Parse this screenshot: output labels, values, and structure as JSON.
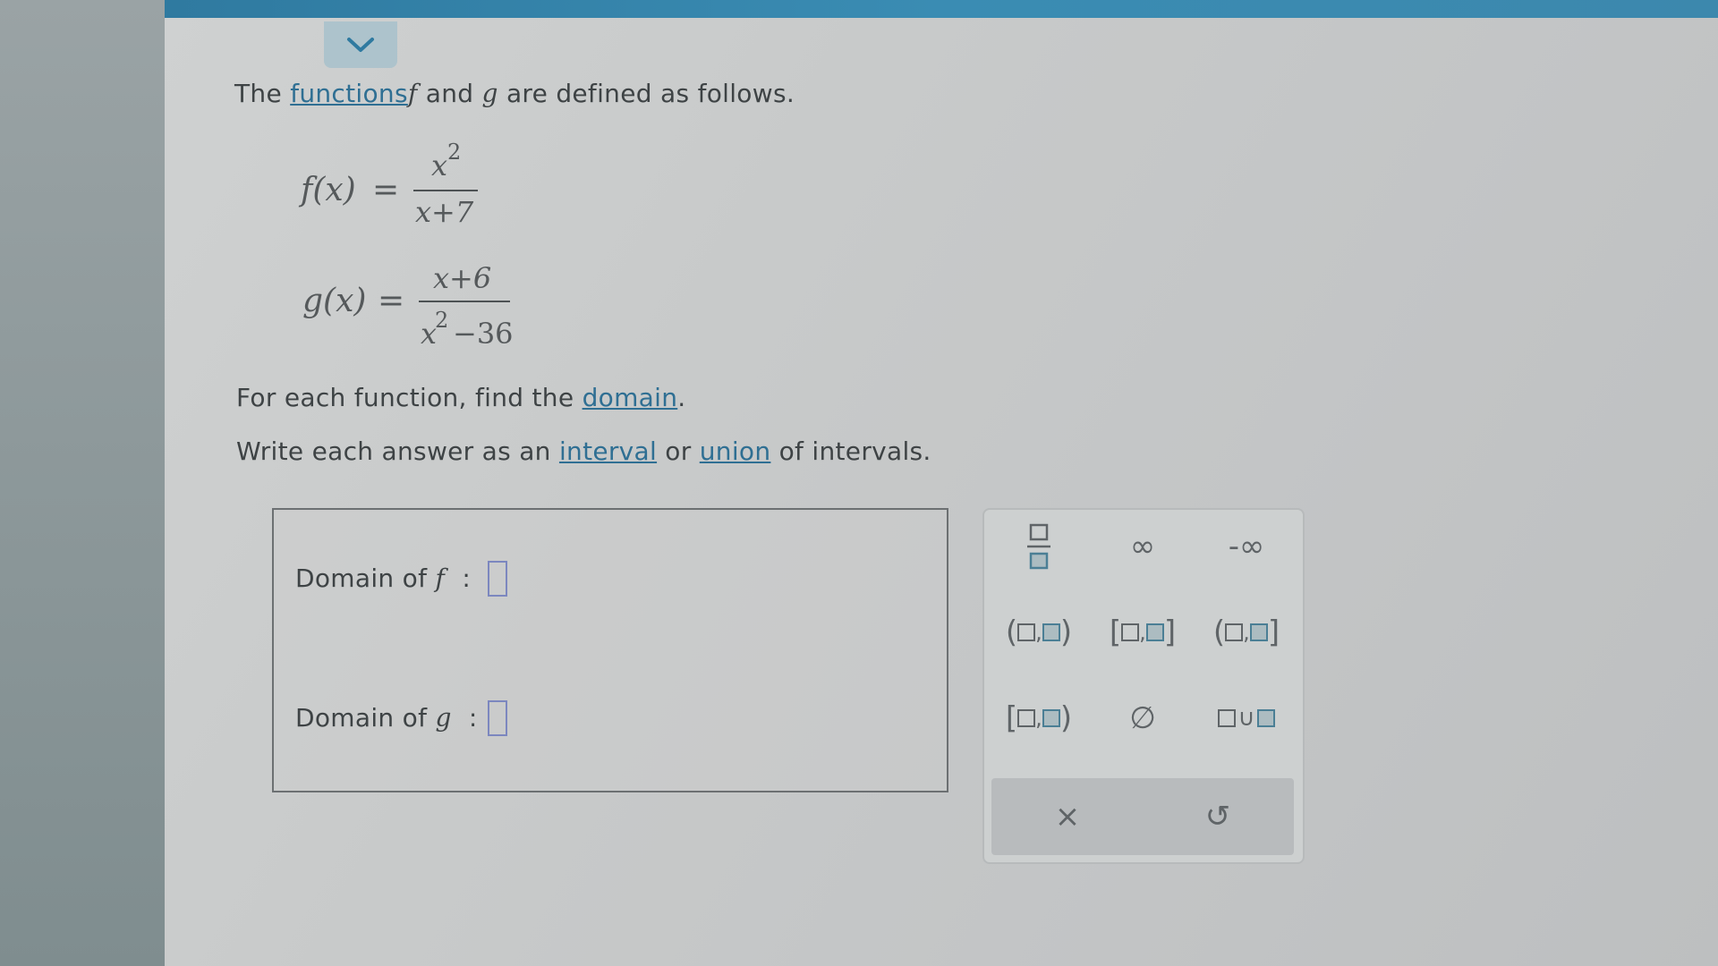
{
  "intro": {
    "the": "The",
    "functions_link": "functions",
    "f": "f",
    "and": "and",
    "g": "g",
    "rest": "are defined as follows."
  },
  "f_def": {
    "lhs": "f(x)",
    "eq": "=",
    "num_base": "x",
    "num_exp": "2",
    "den": "x+7"
  },
  "g_def": {
    "lhs": "g(x)",
    "eq": "=",
    "num": "x+6",
    "den_base": "x",
    "den_exp": "2",
    "den_rest": "−36"
  },
  "instruction1": {
    "text": "For each function, find the",
    "link": "domain",
    "end": "."
  },
  "instruction2": {
    "pre": "Write each answer as an",
    "link1": "interval",
    "mid": "or",
    "link2": "union",
    "post": "of intervals."
  },
  "answers": {
    "f_label": "Domain of",
    "f_var": "f",
    "g_label": "Domain of",
    "g_var": "g",
    "colon": ":"
  },
  "keypad": {
    "infinity": "∞",
    "neg_infinity": "-∞",
    "open_open": [
      "(",
      ",",
      ")"
    ],
    "closed_closed": [
      "[",
      ",",
      "]"
    ],
    "open_closed": [
      "(",
      ",",
      "]"
    ],
    "closed_open": [
      "[",
      ",",
      ")"
    ],
    "empty_set": "∅",
    "union": "∪",
    "clear": "×",
    "undo": "↺"
  },
  "colors": {
    "accent": "#2f6f93",
    "top_bar": "#3a8cb3",
    "slot": "#7c87bf"
  }
}
